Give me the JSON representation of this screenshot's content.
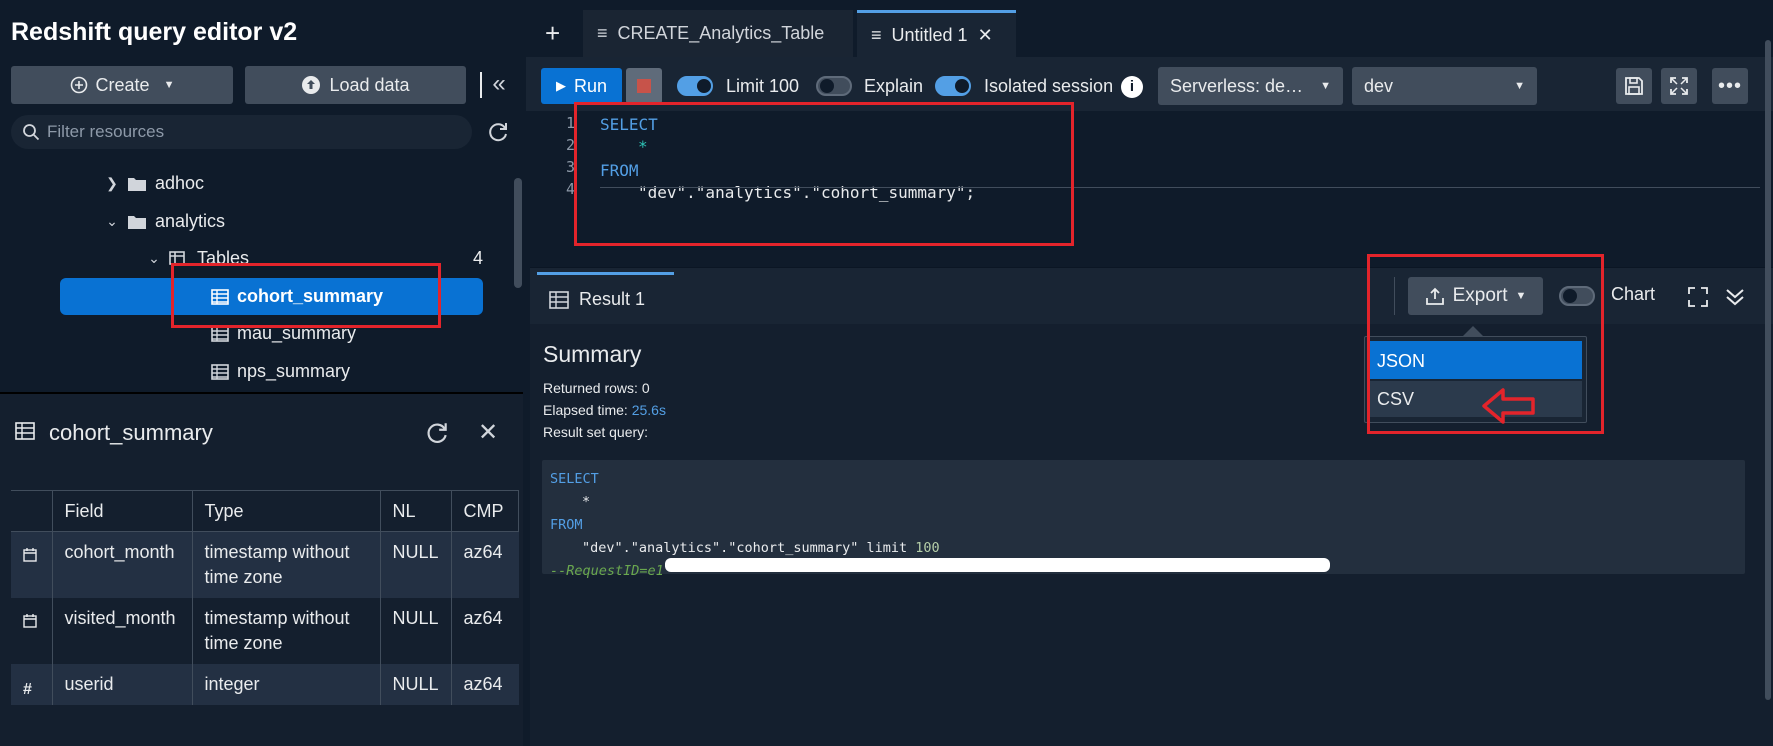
{
  "app": {
    "title": "Redshift query editor v2"
  },
  "sidebar": {
    "create_label": "Create",
    "load_label": "Load data",
    "filter_placeholder": "Filter resources",
    "tree": {
      "adhoc": "adhoc",
      "analytics": "analytics",
      "tables": "Tables",
      "tables_count": "4",
      "items": [
        "cohort_summary",
        "mau_summary",
        "nps_summary"
      ]
    }
  },
  "details": {
    "title": "cohort_summary",
    "columns": [
      "Field",
      "Type",
      "NL",
      "CMP"
    ],
    "rows": [
      {
        "field": "cohort_month",
        "type_line1": "timestamp without",
        "type_line2": "time zone",
        "nl": "NULL",
        "cmp": "az64",
        "icon": "calendar-icon"
      },
      {
        "field": "visited_month",
        "type_line1": "timestamp without",
        "type_line2": "time zone",
        "nl": "NULL",
        "cmp": "az64",
        "icon": "calendar-icon"
      },
      {
        "field": "userid",
        "type_line1": "integer",
        "type_line2": "",
        "nl": "NULL",
        "cmp": "az64",
        "icon": "hash-icon"
      }
    ]
  },
  "tabs": [
    {
      "label": "CREATE_Analytics_Table"
    },
    {
      "label": "Untitled 1"
    }
  ],
  "toolbar": {
    "run_label": "Run",
    "limit_label": "Limit 100",
    "explain_label": "Explain",
    "isolated_label": "Isolated session",
    "workgroup": "Serverless: de…",
    "database": "dev",
    "limit_on": true,
    "explain_on": false,
    "isolated_on": true
  },
  "editor": {
    "lines": [
      "SELECT",
      "*",
      "FROM",
      "\"dev\".\"analytics\".\"cohort_summary\";"
    ],
    "line_numbers": [
      "1",
      "2",
      "3",
      "4"
    ]
  },
  "result": {
    "tab_label": "Result 1",
    "export_label": "Export",
    "chart_label": "Chart",
    "summary_title": "Summary",
    "returned_rows_label": "Returned rows:",
    "returned_rows": "0",
    "elapsed_label": "Elapsed time:",
    "elapsed": "25.6s",
    "result_query_label": "Result set query:",
    "query": {
      "l1": "SELECT",
      "l2": "*",
      "l3": "FROM",
      "l4": "\"dev\".\"analytics\".\"cohort_summary\" limit",
      "l4_num": "100",
      "l5": "--RequestID=e1"
    }
  },
  "export_menu": {
    "items": [
      "JSON",
      "CSV"
    ]
  },
  "colors": {
    "accent": "#0972d3",
    "annotation": "#e3242b",
    "background": "#0f1b2a"
  }
}
